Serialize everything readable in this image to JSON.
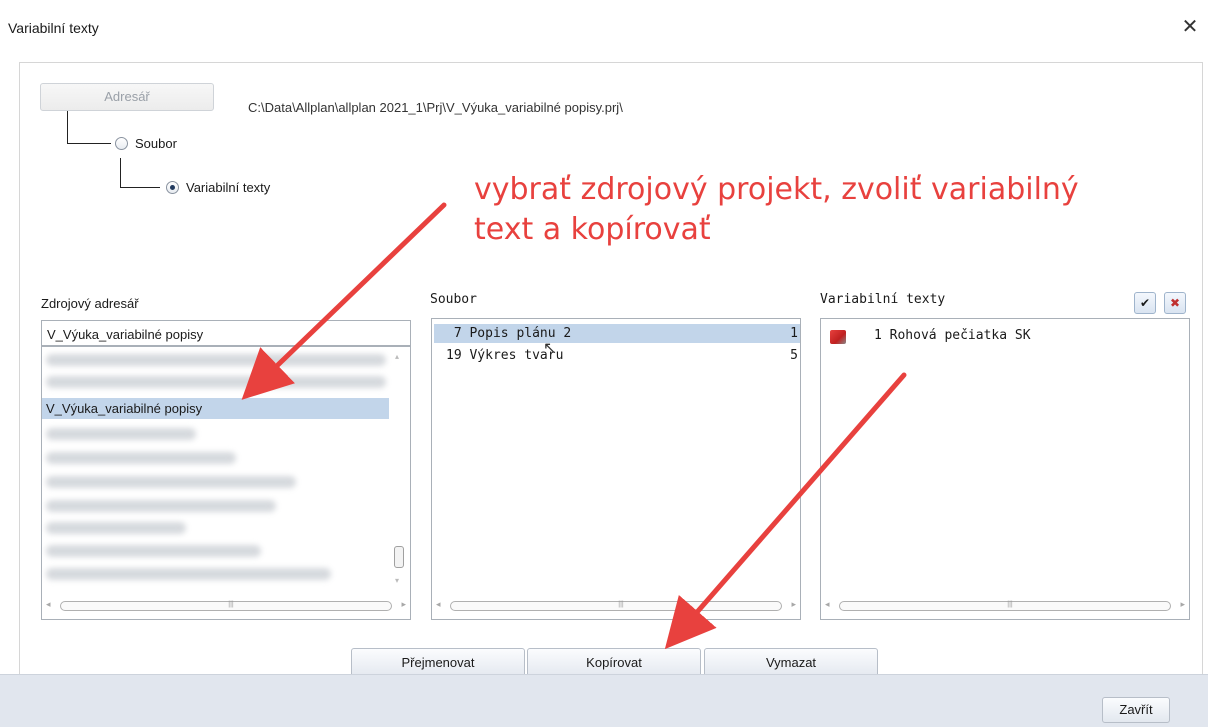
{
  "window": {
    "title": "Variabilní texty",
    "close_glyph": "✕"
  },
  "directory": {
    "button_label": "Adresář",
    "path": "C:\\Data\\Allplan\\allplan 2021_1\\Prj\\V_Výuka_variabilné popisy.prj\\"
  },
  "options": [
    {
      "label": "Soubor",
      "checked": false
    },
    {
      "label": "Variabilní texty",
      "checked": true
    }
  ],
  "annotation": {
    "line1": "vybrať zdrojový projekt, zvoliť variabilný",
    "line2": "text a kopírovať",
    "color": "#e8413e"
  },
  "source": {
    "label": "Zdrojový adresář",
    "combo_value": "V_Výuka_variabilné popisy",
    "selected_item": "V_Výuka_variabilné popisy"
  },
  "files": {
    "label": "Soubor",
    "items": [
      {
        "text": " 7 Popis plánu 2",
        "count": "1",
        "selected": true
      },
      {
        "text": "19 Výkres tvaru",
        "count": "5",
        "selected": false
      }
    ]
  },
  "variables": {
    "label": "Variabilní texty",
    "items": [
      {
        "text": "1 Rohová pečiatka SK"
      }
    ]
  },
  "actions": {
    "rename": "Přejmenovat",
    "copy": "Kopírovat",
    "delete": "Vymazat"
  },
  "footer": {
    "close": "Zavřít"
  },
  "colors": {
    "selection": "#c2d5ea",
    "footer_bg": "#e1e6ee",
    "arrow": "#e8413e"
  }
}
